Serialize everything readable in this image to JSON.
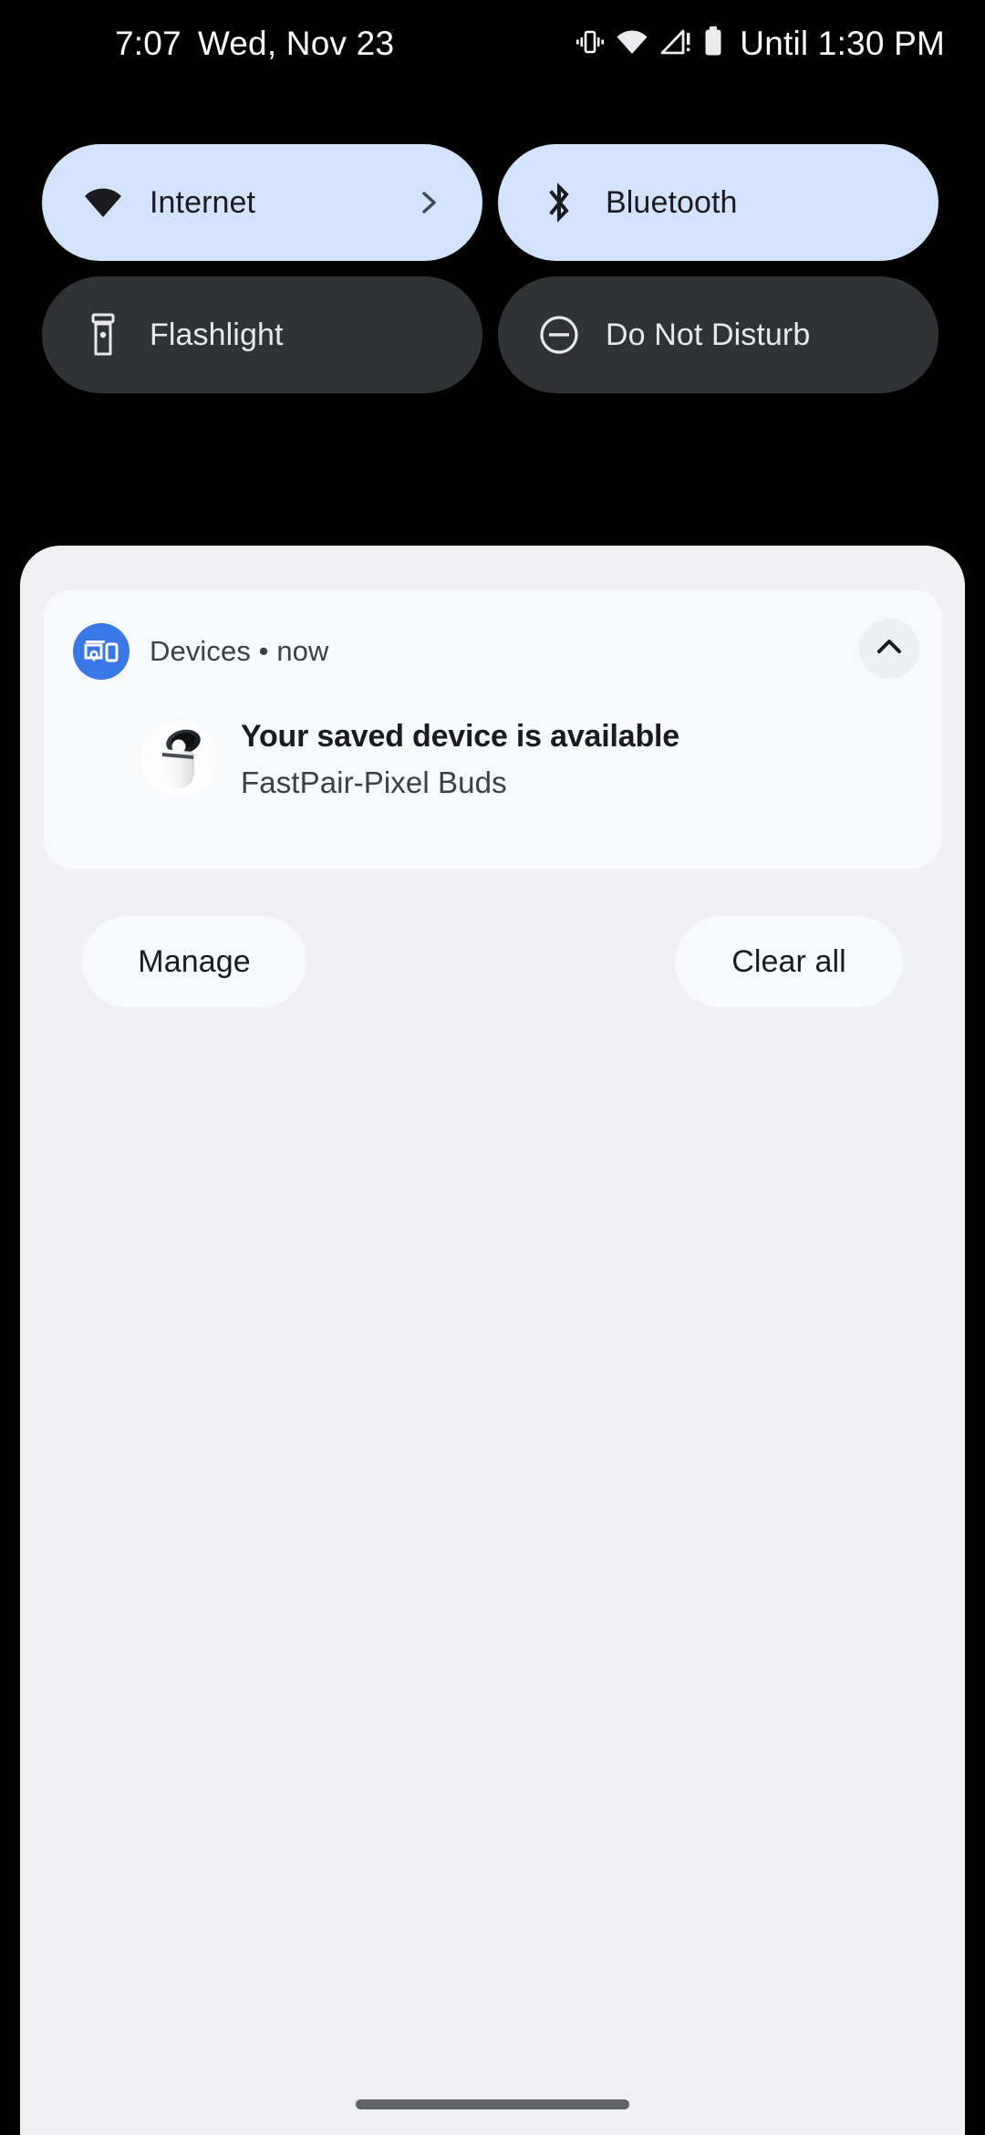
{
  "status_bar": {
    "time": "7:07",
    "date": "Wed, Nov 23",
    "battery_estimate": "Until 1:30 PM",
    "icons": [
      {
        "name": "vibrate-icon"
      },
      {
        "name": "wifi-icon"
      },
      {
        "name": "cellular-signal-no-sim-icon"
      },
      {
        "name": "battery-icon"
      }
    ]
  },
  "quick_settings": {
    "tiles": [
      {
        "label": "Internet",
        "icon": "wifi-icon",
        "state": "active",
        "has_chevron": true
      },
      {
        "label": "Bluetooth",
        "icon": "bluetooth-icon",
        "state": "active",
        "has_chevron": false
      },
      {
        "label": "Flashlight",
        "icon": "flashlight-icon",
        "state": "inactive",
        "has_chevron": false
      },
      {
        "label": "Do Not Disturb",
        "icon": "do-not-disturb-icon",
        "state": "inactive",
        "has_chevron": false
      }
    ],
    "active_color": "#d3e3fd",
    "inactive_color": "#303235"
  },
  "shade": {
    "background_color": "#f0f0f2",
    "notification": {
      "app_name": "Devices",
      "separator": "•",
      "time": "now",
      "header_line": "Devices • now",
      "app_icon": "devices-icon",
      "app_icon_color": "#3b78e7",
      "collapse_icon": "chevron-up-icon",
      "device_thumbnail": "pixel-buds-case-image",
      "title": "Your saved device is available",
      "subtitle": "FastPair-Pixel Buds"
    },
    "footer": {
      "manage_label": "Manage",
      "clear_all_label": "Clear all"
    }
  },
  "navigation": {
    "gesture_bar": "home-gesture-bar"
  }
}
